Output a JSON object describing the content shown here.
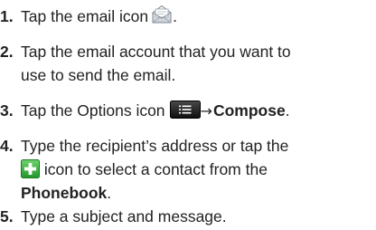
{
  "steps": [
    {
      "number": "1.",
      "text_before": "Tap the email icon",
      "text_after": ".",
      "icon": "email-envelope-icon"
    },
    {
      "number": "2.",
      "line1": "Tap the email account that you want to",
      "line2": "use to send the email."
    },
    {
      "number": "3.",
      "text_before": "Tap the Options icon",
      "arrow": "→",
      "bold": "Compose",
      "text_after": ".",
      "icon": "options-menu-icon"
    },
    {
      "number": "4.",
      "line1": "Type the recipient’s address or tap the",
      "line2_after": "icon to select a contact from the",
      "line3_bold": "Phonebook",
      "line3_after": ".",
      "icon": "add-contact-plus-icon"
    },
    {
      "number": "5.",
      "text": "Type a subject and message."
    }
  ],
  "colors": {
    "text": "#222222",
    "options_icon_bg": "#1a1a1a",
    "plus_icon_green": "#3cb43c"
  }
}
